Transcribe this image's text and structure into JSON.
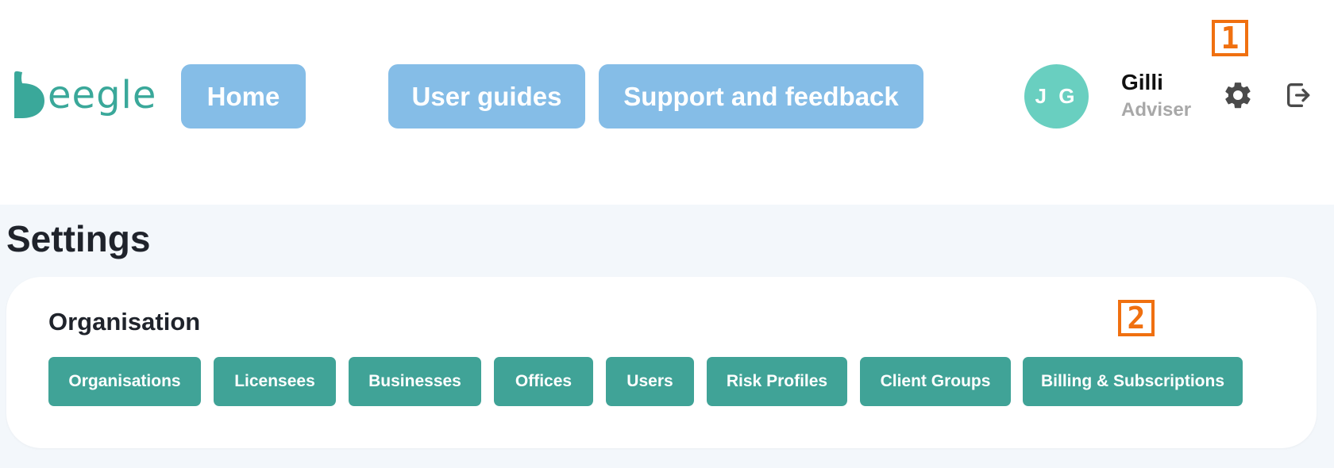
{
  "header": {
    "logo_text": "eegle",
    "nav": {
      "home": "Home",
      "user_guides": "User guides",
      "support": "Support and feedback"
    },
    "user": {
      "initials": "J G",
      "name": "Gilli",
      "role": "Adviser"
    },
    "icons": [
      "gear-icon",
      "logout-icon"
    ]
  },
  "annotations": {
    "first": "1",
    "second": "2"
  },
  "page": {
    "title": "Settings"
  },
  "organisation": {
    "title": "Organisation",
    "buttons": [
      "Organisations",
      "Licensees",
      "Businesses",
      "Offices",
      "Users",
      "Risk Profiles",
      "Client Groups",
      "Billing & Subscriptions"
    ]
  },
  "colors": {
    "nav_button": "#85bde7",
    "avatar": "#69cfc0",
    "org_button": "#40a397",
    "annotation": "#f07010",
    "content_bg": "#f3f7fb",
    "logo": "#3aa89a"
  }
}
